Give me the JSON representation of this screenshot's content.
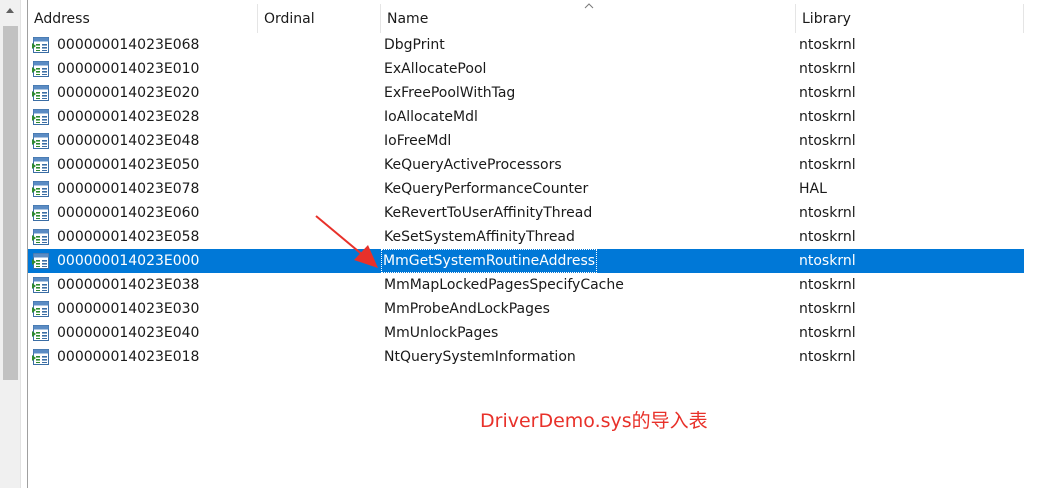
{
  "columns": {
    "address": "Address",
    "ordinal": "Ordinal",
    "name": "Name",
    "library": "Library"
  },
  "rows": [
    {
      "address": "000000014023E068",
      "name": "DbgPrint",
      "library": "ntoskrnl"
    },
    {
      "address": "000000014023E010",
      "name": "ExAllocatePool",
      "library": "ntoskrnl"
    },
    {
      "address": "000000014023E020",
      "name": "ExFreePoolWithTag",
      "library": "ntoskrnl"
    },
    {
      "address": "000000014023E028",
      "name": "IoAllocateMdl",
      "library": "ntoskrnl"
    },
    {
      "address": "000000014023E048",
      "name": "IoFreeMdl",
      "library": "ntoskrnl"
    },
    {
      "address": "000000014023E050",
      "name": "KeQueryActiveProcessors",
      "library": "ntoskrnl"
    },
    {
      "address": "000000014023E078",
      "name": "KeQueryPerformanceCounter",
      "library": "HAL"
    },
    {
      "address": "000000014023E060",
      "name": "KeRevertToUserAffinityThread",
      "library": "ntoskrnl"
    },
    {
      "address": "000000014023E058",
      "name": "KeSetSystemAffinityThread",
      "library": "ntoskrnl"
    },
    {
      "address": "000000014023E000",
      "name": "MmGetSystemRoutineAddress",
      "library": "ntoskrnl",
      "selected": true
    },
    {
      "address": "000000014023E038",
      "name": "MmMapLockedPagesSpecifyCache",
      "library": "ntoskrnl"
    },
    {
      "address": "000000014023E030",
      "name": "MmProbeAndLockPages",
      "library": "ntoskrnl"
    },
    {
      "address": "000000014023E040",
      "name": "MmUnlockPages",
      "library": "ntoskrnl"
    },
    {
      "address": "000000014023E018",
      "name": "NtQuerySystemInformation",
      "library": "ntoskrnl"
    }
  ],
  "row_icon": "import-function-icon",
  "annotation": {
    "text": "DriverDemo.sys的导入表",
    "color": "#e8312a"
  },
  "colors": {
    "selection": "#0078d7",
    "annotation_arrow": "#e8312a"
  }
}
